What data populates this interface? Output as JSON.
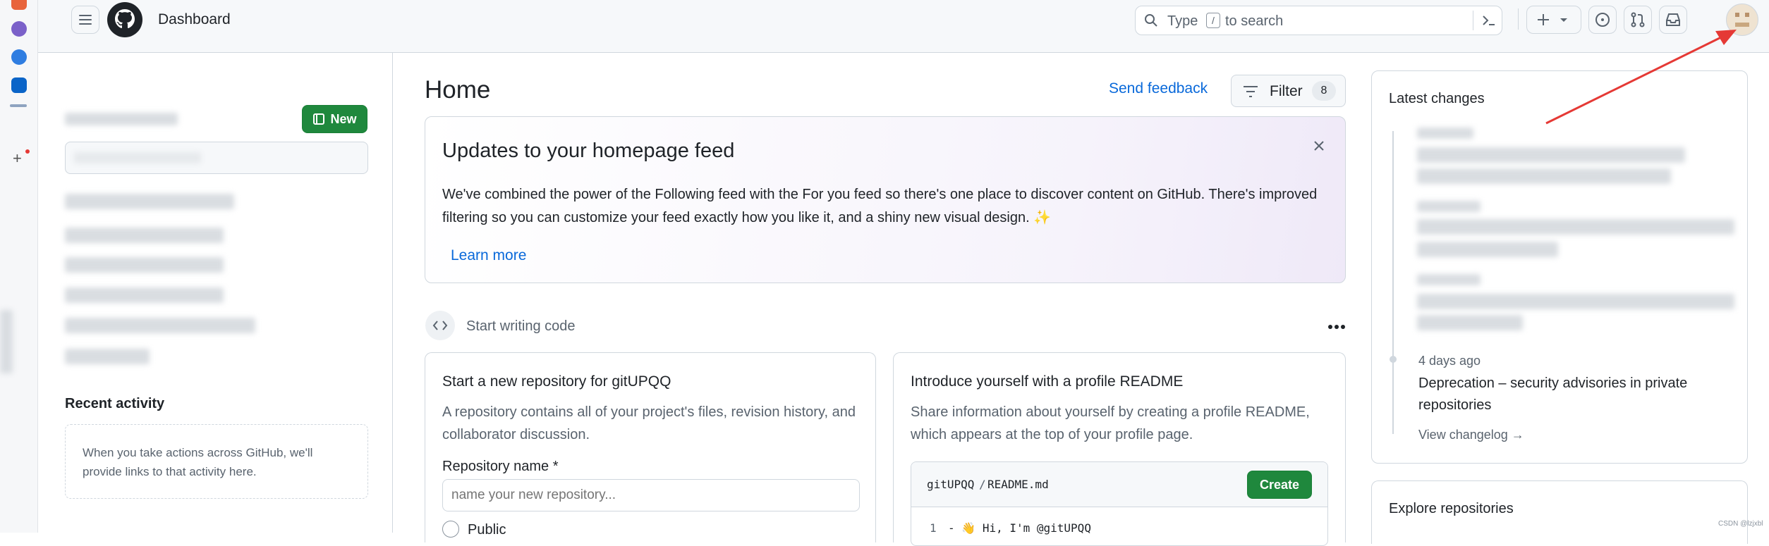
{
  "header": {
    "title": "Dashboard",
    "search_placeholder_pre": "Type",
    "search_key": "/",
    "search_placeholder_post": "to search"
  },
  "left_sidebar": {
    "new_button": "New",
    "recent_activity_heading": "Recent activity",
    "recent_activity_empty": "When you take actions across GitHub, we'll provide links to that activity here."
  },
  "main": {
    "title": "Home",
    "send_feedback": "Send feedback",
    "filter_label": "Filter",
    "filter_count": "8",
    "banner": {
      "heading": "Updates to your homepage feed",
      "body": "We've combined the power of the Following feed with the For you feed so there's one place to discover content on GitHub. There's improved filtering so you can customize your feed exactly how you like it, and a shiny new visual design. ✨",
      "learn_more": "Learn more"
    },
    "start_writing": "Start writing code",
    "new_repo_card": {
      "heading": "Start a new repository for gitUPQQ",
      "body": "A repository contains all of your project's files, revision history, and collaborator discussion.",
      "repo_name_label": "Repository name *",
      "repo_name_placeholder": "name your new repository...",
      "visibility_public": "Public"
    },
    "readme_card": {
      "heading": "Introduce yourself with a profile README",
      "body": "Share information about yourself by creating a profile README, which appears at the top of your profile page.",
      "path_user": "gitUPQQ",
      "path_sep": "/",
      "path_file": "README.md",
      "create_button": "Create",
      "line_number": "1",
      "line_text": "- 👋 Hi, I'm @gitUPQQ"
    }
  },
  "right_sidebar": {
    "latest_changes_heading": "Latest changes",
    "last_entry_date": "4 days ago",
    "last_entry_title": "Deprecation – security advisories in private repositories",
    "view_changelog": "View changelog →",
    "explore_heading": "Explore repositories"
  },
  "watermark": "CSDN @lzjxbl",
  "colors": {
    "accent_link": "#0969da",
    "primary_green": "#1f883d",
    "annotation_arrow": "#e53935"
  }
}
